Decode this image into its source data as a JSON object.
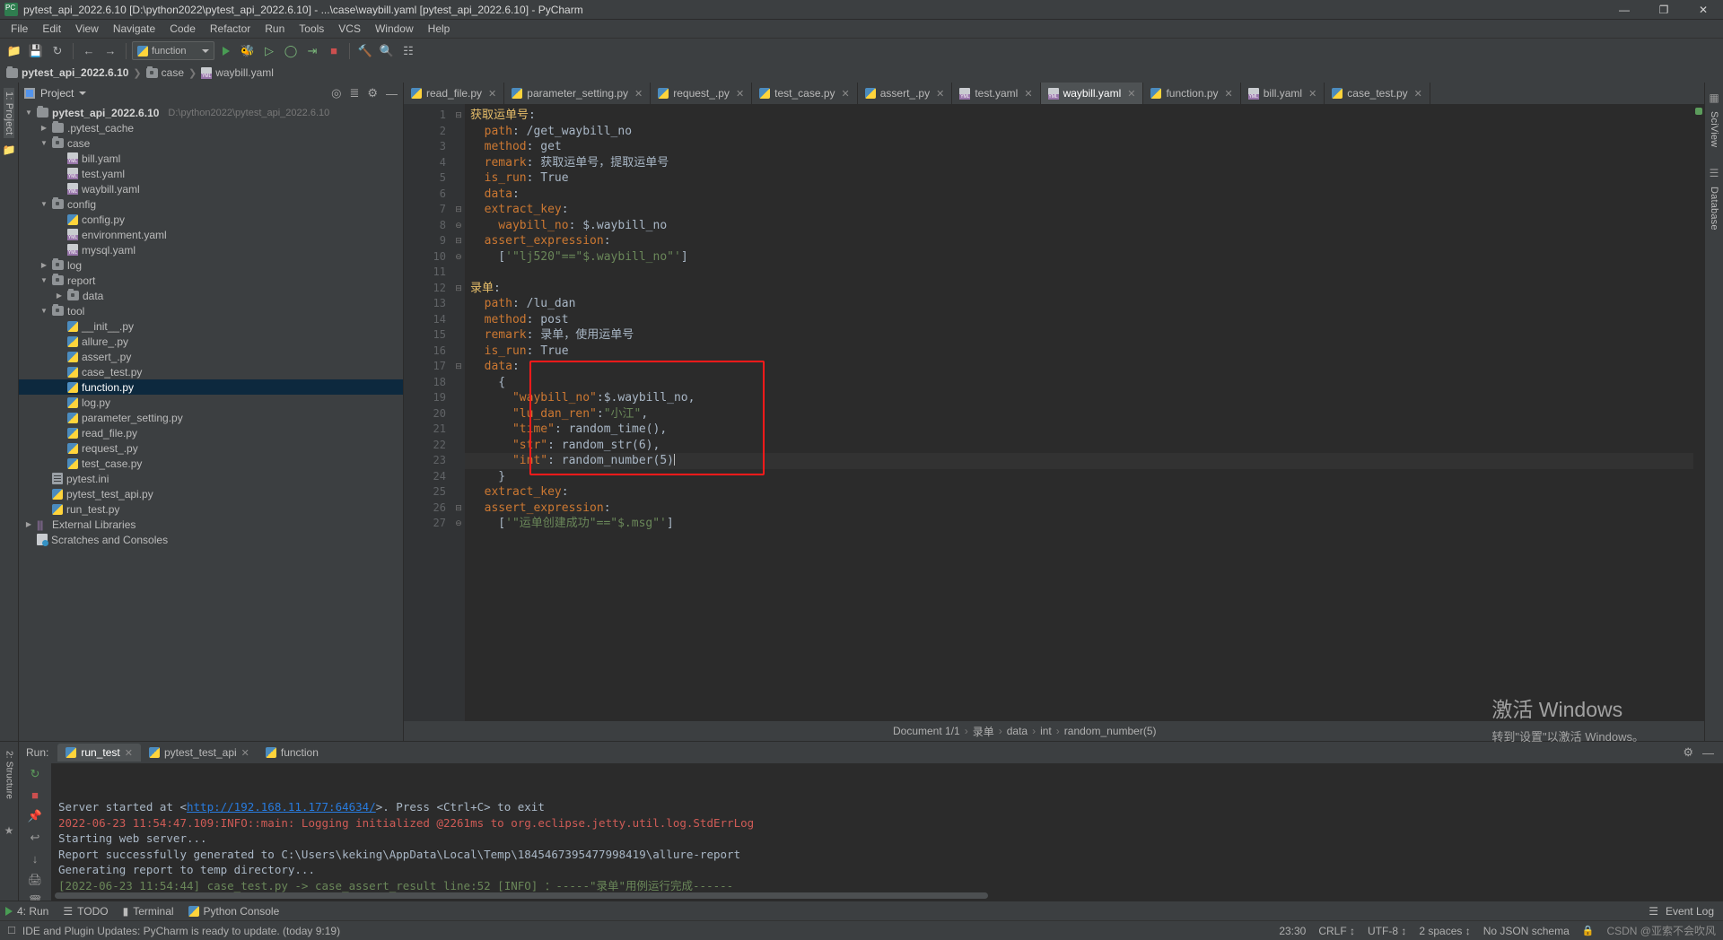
{
  "window": {
    "title": "pytest_api_2022.6.10 [D:\\python2022\\pytest_api_2022.6.10] - ...\\case\\waybill.yaml [pytest_api_2022.6.10] - PyCharm",
    "app_badge": "PC",
    "minimize": "—",
    "maximize": "❐",
    "close": "✕"
  },
  "menu": [
    "File",
    "Edit",
    "View",
    "Navigate",
    "Code",
    "Refactor",
    "Run",
    "Tools",
    "VCS",
    "Window",
    "Help"
  ],
  "toolbar": {
    "run_config": "function",
    "icons": [
      "open-folder-icon",
      "save-icon",
      "sync-icon",
      "back-arrow-icon",
      "forward-arrow-icon",
      "run-icon",
      "debug-icon",
      "run-coverage-icon",
      "profile-icon",
      "run-to-cursor-icon",
      "stop-icon",
      "build-icon",
      "search-everywhere-icon",
      "structure-icon"
    ]
  },
  "breadcrumb": [
    {
      "label": "pytest_api_2022.6.10",
      "icon": "folder-icon",
      "bold": true
    },
    {
      "label": "case",
      "icon": "source-folder-icon",
      "bold": false
    },
    {
      "label": "waybill.yaml",
      "icon": "yaml-file-icon",
      "bold": false
    }
  ],
  "left_rail": [
    {
      "label": "1: Project",
      "selected": true
    },
    {
      "label": "structure-icon",
      "selected": false
    }
  ],
  "right_rail": [
    "SciView",
    "Database"
  ],
  "project_panel": {
    "title": "Project",
    "header_icons": [
      "target-icon",
      "collapse-all-icon",
      "settings-icon",
      "hide-icon"
    ],
    "tree": [
      {
        "label": "pytest_api_2022.6.10",
        "path": "D:\\python2022\\pytest_api_2022.6.10",
        "indent": 0,
        "arrow": "down",
        "icon": "folder-icon",
        "bold": true,
        "selected": false
      },
      {
        "label": ".pytest_cache",
        "indent": 1,
        "arrow": "right",
        "icon": "folder-icon",
        "selected": false
      },
      {
        "label": "case",
        "indent": 1,
        "arrow": "down",
        "icon": "source-folder-icon",
        "selected": false
      },
      {
        "label": "bill.yaml",
        "indent": 2,
        "arrow": "none",
        "icon": "yaml-file-icon",
        "selected": false
      },
      {
        "label": "test.yaml",
        "indent": 2,
        "arrow": "none",
        "icon": "yaml-file-icon",
        "selected": false
      },
      {
        "label": "waybill.yaml",
        "indent": 2,
        "arrow": "none",
        "icon": "yaml-file-icon",
        "selected": false
      },
      {
        "label": "config",
        "indent": 1,
        "arrow": "down",
        "icon": "source-folder-icon",
        "selected": false
      },
      {
        "label": "config.py",
        "indent": 2,
        "arrow": "none",
        "icon": "python-file-icon",
        "selected": false
      },
      {
        "label": "environment.yaml",
        "indent": 2,
        "arrow": "none",
        "icon": "yaml-file-icon",
        "selected": false
      },
      {
        "label": "mysql.yaml",
        "indent": 2,
        "arrow": "none",
        "icon": "yaml-file-icon",
        "selected": false
      },
      {
        "label": "log",
        "indent": 1,
        "arrow": "right",
        "icon": "source-folder-icon",
        "selected": false
      },
      {
        "label": "report",
        "indent": 1,
        "arrow": "down",
        "icon": "source-folder-icon",
        "selected": false
      },
      {
        "label": "data",
        "indent": 2,
        "arrow": "right",
        "icon": "source-folder-icon",
        "selected": false
      },
      {
        "label": "tool",
        "indent": 1,
        "arrow": "down",
        "icon": "source-folder-icon",
        "selected": false
      },
      {
        "label": "__init__.py",
        "indent": 2,
        "arrow": "none",
        "icon": "python-file-icon",
        "selected": false
      },
      {
        "label": "allure_.py",
        "indent": 2,
        "arrow": "none",
        "icon": "python-file-icon",
        "selected": false
      },
      {
        "label": "assert_.py",
        "indent": 2,
        "arrow": "none",
        "icon": "python-file-icon",
        "selected": false
      },
      {
        "label": "case_test.py",
        "indent": 2,
        "arrow": "none",
        "icon": "python-file-icon",
        "selected": false
      },
      {
        "label": "function.py",
        "indent": 2,
        "arrow": "none",
        "icon": "python-file-icon",
        "selected": true
      },
      {
        "label": "log.py",
        "indent": 2,
        "arrow": "none",
        "icon": "python-file-icon",
        "selected": false
      },
      {
        "label": "parameter_setting.py",
        "indent": 2,
        "arrow": "none",
        "icon": "python-file-icon",
        "selected": false
      },
      {
        "label": "read_file.py",
        "indent": 2,
        "arrow": "none",
        "icon": "python-file-icon",
        "selected": false
      },
      {
        "label": "request_.py",
        "indent": 2,
        "arrow": "none",
        "icon": "python-file-icon",
        "selected": false
      },
      {
        "label": "test_case.py",
        "indent": 2,
        "arrow": "none",
        "icon": "python-file-icon",
        "selected": false
      },
      {
        "label": "pytest.ini",
        "indent": 1,
        "arrow": "none",
        "icon": "ini-file-icon",
        "selected": false
      },
      {
        "label": "pytest_test_api.py",
        "indent": 1,
        "arrow": "none",
        "icon": "python-file-icon",
        "selected": false
      },
      {
        "label": "run_test.py",
        "indent": 1,
        "arrow": "none",
        "icon": "python-file-icon",
        "selected": false
      },
      {
        "label": "External Libraries",
        "indent": 0,
        "arrow": "right",
        "icon": "library-icon",
        "selected": false
      },
      {
        "label": "Scratches and Consoles",
        "indent": 0,
        "arrow": "none",
        "icon": "scratches-icon",
        "selected": false
      }
    ]
  },
  "editor_tabs": [
    {
      "label": "read_file.py",
      "icon": "python-file-icon",
      "active": false
    },
    {
      "label": "parameter_setting.py",
      "icon": "python-file-icon",
      "active": false
    },
    {
      "label": "request_.py",
      "icon": "python-file-icon",
      "active": false
    },
    {
      "label": "test_case.py",
      "icon": "python-file-icon",
      "active": false
    },
    {
      "label": "assert_.py",
      "icon": "python-file-icon",
      "active": false
    },
    {
      "label": "test.yaml",
      "icon": "yaml-file-icon",
      "active": false
    },
    {
      "label": "waybill.yaml",
      "icon": "yaml-file-icon",
      "active": true
    },
    {
      "label": "function.py",
      "icon": "python-file-icon",
      "active": false
    },
    {
      "label": "bill.yaml",
      "icon": "yaml-file-icon",
      "active": false
    },
    {
      "label": "case_test.py",
      "icon": "python-file-icon",
      "active": false
    }
  ],
  "code": {
    "lines": [
      {
        "n": 1,
        "fold": "minus",
        "parts": [
          {
            "t": "获取运单号",
            "c": "k-anchor"
          },
          {
            "t": ":",
            "c": "k-pl"
          }
        ]
      },
      {
        "n": 2,
        "fold": "",
        "parts": [
          {
            "t": "  path",
            "c": "k-key"
          },
          {
            "t": ": ",
            "c": "k-pl"
          },
          {
            "t": "/get_waybill_no",
            "c": "k-val"
          }
        ]
      },
      {
        "n": 3,
        "fold": "",
        "parts": [
          {
            "t": "  method",
            "c": "k-key"
          },
          {
            "t": ": ",
            "c": "k-pl"
          },
          {
            "t": "get",
            "c": "k-val"
          }
        ]
      },
      {
        "n": 4,
        "fold": "",
        "parts": [
          {
            "t": "  remark",
            "c": "k-key"
          },
          {
            "t": ": ",
            "c": "k-pl"
          },
          {
            "t": "获取运单号，提取运单号",
            "c": "k-val"
          }
        ]
      },
      {
        "n": 5,
        "fold": "",
        "parts": [
          {
            "t": "  is_run",
            "c": "k-key"
          },
          {
            "t": ": ",
            "c": "k-pl"
          },
          {
            "t": "True",
            "c": "k-val"
          }
        ]
      },
      {
        "n": 6,
        "fold": "",
        "parts": [
          {
            "t": "  data",
            "c": "k-key"
          },
          {
            "t": ":",
            "c": "k-pl"
          }
        ]
      },
      {
        "n": 7,
        "fold": "minus",
        "parts": [
          {
            "t": "  extract_key",
            "c": "k-key"
          },
          {
            "t": ":",
            "c": "k-pl"
          }
        ]
      },
      {
        "n": 8,
        "fold": "end",
        "parts": [
          {
            "t": "    waybill_no",
            "c": "k-key"
          },
          {
            "t": ": ",
            "c": "k-pl"
          },
          {
            "t": "$.waybill_no",
            "c": "k-val"
          }
        ]
      },
      {
        "n": 9,
        "fold": "minus",
        "parts": [
          {
            "t": "  assert_expression",
            "c": "k-key"
          },
          {
            "t": ":",
            "c": "k-pl"
          }
        ]
      },
      {
        "n": 10,
        "fold": "end",
        "parts": [
          {
            "t": "    [",
            "c": "k-pl"
          },
          {
            "t": "'\"lj520\"==\"$.waybill_no\"'",
            "c": "k-str"
          },
          {
            "t": "]",
            "c": "k-pl"
          }
        ]
      },
      {
        "n": 11,
        "fold": "",
        "parts": []
      },
      {
        "n": 12,
        "fold": "minus",
        "parts": [
          {
            "t": "录单",
            "c": "k-anchor"
          },
          {
            "t": ":",
            "c": "k-pl"
          }
        ]
      },
      {
        "n": 13,
        "fold": "",
        "parts": [
          {
            "t": "  path",
            "c": "k-key"
          },
          {
            "t": ": ",
            "c": "k-pl"
          },
          {
            "t": "/lu_dan",
            "c": "k-val"
          }
        ]
      },
      {
        "n": 14,
        "fold": "",
        "parts": [
          {
            "t": "  method",
            "c": "k-key"
          },
          {
            "t": ": ",
            "c": "k-pl"
          },
          {
            "t": "post",
            "c": "k-val"
          }
        ]
      },
      {
        "n": 15,
        "fold": "",
        "parts": [
          {
            "t": "  remark",
            "c": "k-key"
          },
          {
            "t": ": ",
            "c": "k-pl"
          },
          {
            "t": "录单，使用运单号",
            "c": "k-val"
          }
        ]
      },
      {
        "n": 16,
        "fold": "",
        "parts": [
          {
            "t": "  is_run",
            "c": "k-key"
          },
          {
            "t": ": ",
            "c": "k-pl"
          },
          {
            "t": "True",
            "c": "k-val"
          }
        ]
      },
      {
        "n": 17,
        "fold": "minus",
        "parts": [
          {
            "t": "  data",
            "c": "k-key"
          },
          {
            "t": ":",
            "c": "k-pl"
          }
        ]
      },
      {
        "n": 18,
        "fold": "",
        "parts": [
          {
            "t": "    {",
            "c": "k-val"
          }
        ]
      },
      {
        "n": 19,
        "fold": "",
        "parts": [
          {
            "t": "      ",
            "c": "k-pl"
          },
          {
            "t": "\"waybill_no\"",
            "c": "k-key"
          },
          {
            "t": ":$.waybill_no,",
            "c": "k-val"
          }
        ]
      },
      {
        "n": 20,
        "fold": "",
        "parts": [
          {
            "t": "      ",
            "c": "k-pl"
          },
          {
            "t": "\"lu_dan_ren\"",
            "c": "k-key"
          },
          {
            "t": ":",
            "c": "k-val"
          },
          {
            "t": "\"小江\"",
            "c": "k-str"
          },
          {
            "t": ",",
            "c": "k-val"
          }
        ]
      },
      {
        "n": 21,
        "fold": "",
        "parts": [
          {
            "t": "      ",
            "c": "k-pl"
          },
          {
            "t": "\"time\"",
            "c": "k-key"
          },
          {
            "t": ": random_time(),",
            "c": "k-val"
          }
        ]
      },
      {
        "n": 22,
        "fold": "",
        "parts": [
          {
            "t": "      ",
            "c": "k-pl"
          },
          {
            "t": "\"str\"",
            "c": "k-key"
          },
          {
            "t": ": random_str(6),",
            "c": "k-val"
          }
        ]
      },
      {
        "n": 23,
        "fold": "",
        "cur": true,
        "caret": true,
        "parts": [
          {
            "t": "      ",
            "c": "k-pl"
          },
          {
            "t": "\"int\"",
            "c": "k-key"
          },
          {
            "t": ": random_number(5)",
            "c": "k-val"
          }
        ]
      },
      {
        "n": 24,
        "fold": "",
        "parts": [
          {
            "t": "    }",
            "c": "k-val"
          }
        ]
      },
      {
        "n": 25,
        "fold": "",
        "parts": [
          {
            "t": "  extract_key",
            "c": "k-key"
          },
          {
            "t": ":",
            "c": "k-pl"
          }
        ]
      },
      {
        "n": 26,
        "fold": "minus",
        "parts": [
          {
            "t": "  assert_expression",
            "c": "k-key"
          },
          {
            "t": ":",
            "c": "k-pl"
          }
        ]
      },
      {
        "n": 27,
        "fold": "end",
        "parts": [
          {
            "t": "    [",
            "c": "k-pl"
          },
          {
            "t": "'\"运单创建成功\"==\"$.msg\"'",
            "c": "k-str"
          },
          {
            "t": "]",
            "c": "k-pl"
          }
        ]
      }
    ]
  },
  "editor_breadcrumb": {
    "document": "Document 1/1",
    "items": [
      "录单",
      "data",
      "int",
      "random_number(5)"
    ],
    "separator": "›"
  },
  "run_panel": {
    "run_label": "Run:",
    "tabs": [
      {
        "label": "run_test",
        "active": true,
        "icon": "run-tab-icon"
      },
      {
        "label": "pytest_test_api",
        "active": false,
        "icon": "run-tab-icon"
      },
      {
        "label": "function",
        "active": false,
        "icon": "run-tab-icon"
      }
    ],
    "console_lines": [
      {
        "text": "[2022-06-23 11:54:44] case_test.py -> case_assert_result line:52 [INFO] ：-----\"录单\"用例运行完成------",
        "color": "c-green"
      },
      {
        "text": "Generating report to temp directory...",
        "color": "c-white"
      },
      {
        "text": "Report successfully generated to C:\\Users\\keking\\AppData\\Local\\Temp\\1845467395477998419\\allure-report",
        "color": "c-white"
      },
      {
        "text": "Starting web server...",
        "color": "c-white"
      },
      {
        "text": "2022-06-23 11:54:47.109:INFO::main: Logging initialized @2261ms to org.eclipse.jetty.util.log.StdErrLog",
        "color": "c-red"
      },
      {
        "text": "Server started at <",
        "link": "http://192.168.11.177:64634/",
        "tail": ">. Press <Ctrl+C> to exit",
        "color": "c-white"
      }
    ]
  },
  "watermark": {
    "line1": "激活 Windows",
    "line2": "转到\"设置\"以激活 Windows。"
  },
  "toolwindow_bar": {
    "left": [
      {
        "label": "4: Run",
        "icon": "run-icon"
      },
      {
        "label": "TODO",
        "icon": "todo-icon"
      },
      {
        "label": "Terminal",
        "icon": "terminal-icon"
      },
      {
        "label": "Python Console",
        "icon": "python-console-icon"
      }
    ],
    "right": [
      {
        "label": "Event Log",
        "icon": "event-log-icon"
      }
    ]
  },
  "statusbar": {
    "message": "IDE and Plugin Updates: PyCharm is ready to update. (today 9:19)",
    "right": [
      "23:30",
      "CRLF ↕",
      "UTF-8 ↕",
      "2 spaces ↕",
      "No JSON schema",
      "lock-icon"
    ],
    "csdn": "CSDN @亚索不会吹风"
  }
}
